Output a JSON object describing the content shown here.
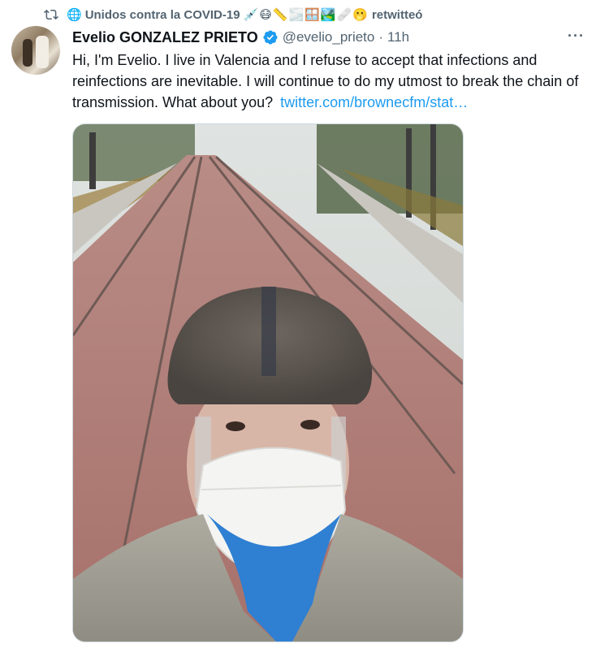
{
  "retweet": {
    "account_name": "Unidos contra la COVID-19",
    "emojis": "💉😷📏🌫️🪟🏞️🩹🫢",
    "action": "retwitteó"
  },
  "author": {
    "display_name": "Evelio GONZALEZ PRIETO",
    "handle": "@evelio_prieto",
    "separator": "·",
    "time": "11h"
  },
  "tweet": {
    "text": "Hi, I'm Evelio. I live in Valencia and I refuse to accept that infections and reinfections are inevitable. I will continue to do my utmost to break the chain of transmission. What about you?",
    "link": "twitter.com/brownecfm/stat…"
  },
  "more_label": "···",
  "colors": {
    "accent": "#1d9bf0",
    "secondary_text": "#536471",
    "verified": "#1d9bf0"
  }
}
